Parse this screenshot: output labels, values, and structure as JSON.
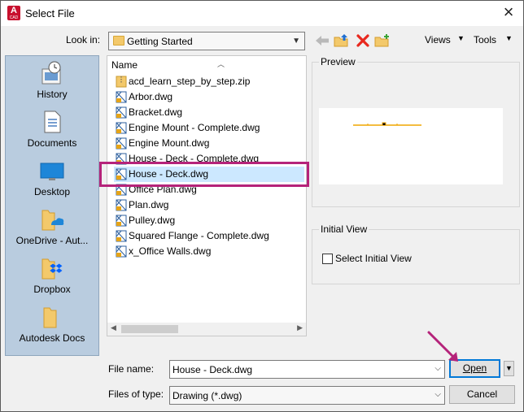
{
  "window": {
    "title": "Select File",
    "app_icon_letter": "A",
    "app_icon_sub": "CAD"
  },
  "toolbar": {
    "look_in_label": "Look in:",
    "look_in_value": "Getting Started",
    "views_label": "Views",
    "tools_label": "Tools"
  },
  "places": [
    {
      "label": "History",
      "icon": "history-icon"
    },
    {
      "label": "Documents",
      "icon": "documents-icon"
    },
    {
      "label": "Desktop",
      "icon": "desktop-icon"
    },
    {
      "label": "OneDrive - Aut...",
      "icon": "onedrive-folder-icon"
    },
    {
      "label": "Dropbox",
      "icon": "dropbox-folder-icon"
    },
    {
      "label": "Autodesk Docs",
      "icon": "autodesk-docs-folder-icon"
    }
  ],
  "filelist": {
    "column_header": "Name",
    "files": [
      {
        "name": "acd_learn_step_by_step.zip",
        "type": "zip"
      },
      {
        "name": "Arbor.dwg",
        "type": "dwg"
      },
      {
        "name": "Bracket.dwg",
        "type": "dwg"
      },
      {
        "name": "Engine Mount - Complete.dwg",
        "type": "dwg"
      },
      {
        "name": "Engine Mount.dwg",
        "type": "dwg"
      },
      {
        "name": "House - Deck - Complete.dwg",
        "type": "dwg"
      },
      {
        "name": "House - Deck.dwg",
        "type": "dwg",
        "selected": true
      },
      {
        "name": "Office Plan.dwg",
        "type": "dwg"
      },
      {
        "name": "Plan.dwg",
        "type": "dwg"
      },
      {
        "name": "Pulley.dwg",
        "type": "dwg"
      },
      {
        "name": "Squared Flange - Complete.dwg",
        "type": "dwg"
      },
      {
        "name": "x_Office Walls.dwg",
        "type": "dwg"
      }
    ]
  },
  "preview": {
    "label": "Preview"
  },
  "initial_view": {
    "label": "Initial View",
    "checkbox_label": "Select Initial View",
    "checked": false
  },
  "footer": {
    "file_name_label": "File name:",
    "file_name_value": "House - Deck.dwg",
    "files_of_type_label": "Files of type:",
    "files_of_type_value": "Drawing (*.dwg)",
    "open_label": "Open",
    "cancel_label": "Cancel"
  },
  "colors": {
    "highlight": "#b5237a",
    "selection": "#cce8ff",
    "places_bg": "#b9ccdf",
    "accent": "#0078d7"
  }
}
